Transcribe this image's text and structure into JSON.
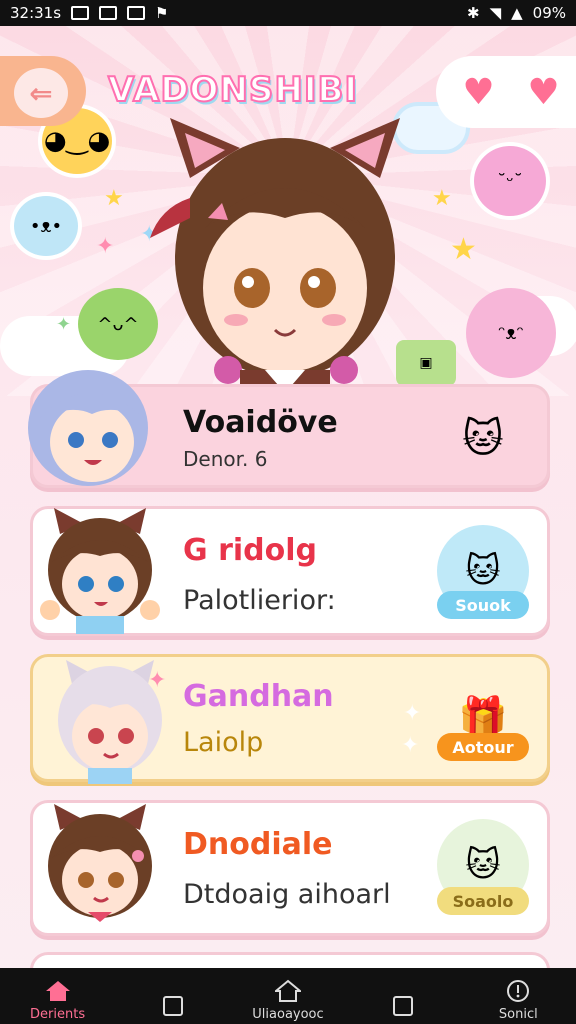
{
  "status_bar": {
    "time": "32:31s",
    "battery": "09%"
  },
  "header": {
    "title": "VADONSHIBI"
  },
  "cards": [
    {
      "title": "Voaidöve",
      "subtitle": "Denor. 6",
      "badge": "",
      "title_color": "#111111",
      "bg": "#fbd3de"
    },
    {
      "title": "G ridolg",
      "subtitle": "Palotlierior:",
      "badge": "Souok",
      "title_color": "#e8344a",
      "bg": "#ffffff",
      "badge_color": "#7ad0f0"
    },
    {
      "title": "Gandhan",
      "subtitle": "Laiolp",
      "badge": "Aotour",
      "title_color": "#d56be0",
      "bg": "#fff3d6",
      "badge_color": "#f7941d"
    },
    {
      "title": "Dnodiale",
      "subtitle": "Dtdoaig aihoarl",
      "badge": "Soaolo",
      "title_color": "#f05a22",
      "bg": "#ffffff",
      "badge_color": "#f1dc7e"
    }
  ],
  "nav": [
    {
      "label": "Derients",
      "icon": "home-icon"
    },
    {
      "label": "",
      "icon": "square-icon"
    },
    {
      "label": "Uliaoayooc",
      "icon": "home-outline-icon"
    },
    {
      "label": "",
      "icon": "square-icon"
    },
    {
      "label": "Sonicl",
      "icon": "info-icon"
    }
  ],
  "colors": {
    "accent": "#ff6f94",
    "back_bg": "#f9b58f",
    "card_border": "#f4c9d4"
  }
}
